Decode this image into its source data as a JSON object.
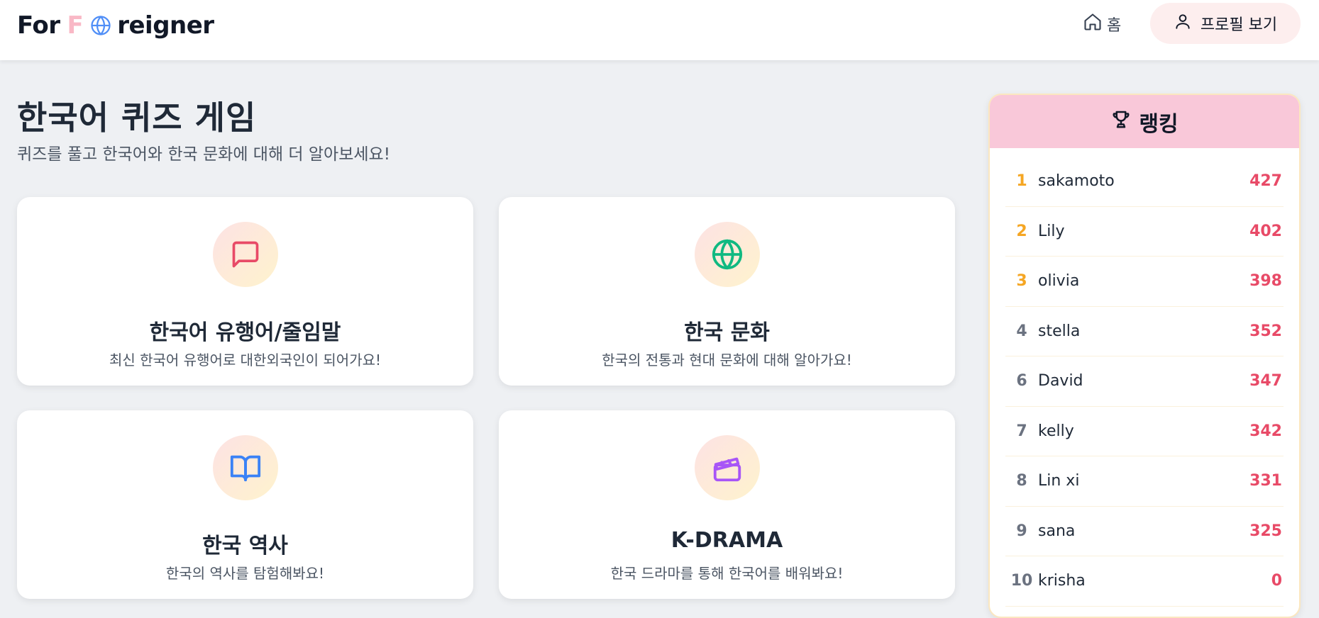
{
  "header": {
    "logo": {
      "part1": "For",
      "part2": "F",
      "part3": "reigner"
    },
    "home_label": "홈",
    "profile_label": "프로필 보기"
  },
  "main": {
    "title": "한국어 퀴즈 게임",
    "subtitle": "퀴즈를 풀고 한국어와 한국 문화에 대해 더 알아보세요!"
  },
  "categories": [
    {
      "title": "한국어 유행어/줄임말",
      "desc": "최신 한국어 유행어로 대한외국인이 되어가요!",
      "icon": "message-icon",
      "color": "#e84a67"
    },
    {
      "title": "한국 문화",
      "desc": "한국의 전통과 현대 문화에 대해 알아가요!",
      "icon": "globe-icon",
      "color": "#10b981"
    },
    {
      "title": "한국 역사",
      "desc": "한국의 역사를 탐험해봐요!",
      "icon": "book-icon",
      "color": "#3b82f6"
    },
    {
      "title": "K-DRAMA",
      "desc": "한국 드라마를 통해 한국어를 배워봐요!",
      "icon": "clapperboard-icon",
      "color": "#a855f7"
    }
  ],
  "ranking": {
    "title": "랭킹",
    "rows": [
      {
        "rank": "1",
        "name": "sakamoto",
        "score": "427"
      },
      {
        "rank": "2",
        "name": "Lily",
        "score": "402"
      },
      {
        "rank": "3",
        "name": "olivia",
        "score": "398"
      },
      {
        "rank": "4",
        "name": "stella",
        "score": "352"
      },
      {
        "rank": "6",
        "name": "David",
        "score": "347"
      },
      {
        "rank": "7",
        "name": "kelly",
        "score": "342"
      },
      {
        "rank": "8",
        "name": "Lin xi",
        "score": "331"
      },
      {
        "rank": "9",
        "name": "sana",
        "score": "325"
      },
      {
        "rank": "10",
        "name": "krisha",
        "score": "0"
      }
    ]
  },
  "colors": {
    "accent_pink": "#f9c8d9",
    "score_red": "#e84a67",
    "top_rank_gold": "#f5a623"
  }
}
